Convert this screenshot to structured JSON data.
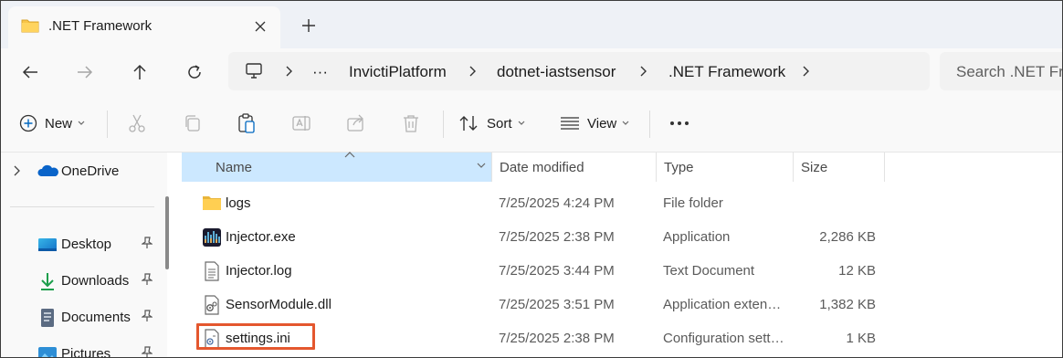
{
  "window": {
    "tab_title": ".NET Framework"
  },
  "address_bar": {
    "more_label": "···",
    "breadcrumbs": [
      "InvictiPlatform",
      "dotnet-iastsensor",
      ".NET Framework"
    ],
    "search_placeholder": "Search .NET Framework"
  },
  "toolbar": {
    "new_label": "New",
    "sort_label": "Sort",
    "view_label": "View",
    "more_label": "···"
  },
  "sidebar": {
    "items": [
      {
        "label": "OneDrive",
        "icon": "onedrive-icon",
        "pinned": false
      },
      {
        "label": "Desktop",
        "icon": "desktop-icon",
        "pinned": true
      },
      {
        "label": "Downloads",
        "icon": "downloads-icon",
        "pinned": true
      },
      {
        "label": "Documents",
        "icon": "documents-icon",
        "pinned": true
      },
      {
        "label": "Pictures",
        "icon": "pictures-icon",
        "pinned": true
      }
    ]
  },
  "file_list": {
    "columns": {
      "name": "Name",
      "date": "Date modified",
      "type": "Type",
      "size": "Size"
    },
    "rows": [
      {
        "name": "logs",
        "date": "7/25/2025 4:24 PM",
        "type": "File folder",
        "size": "",
        "icon": "folder-icon"
      },
      {
        "name": "Injector.exe",
        "date": "7/25/2025 2:38 PM",
        "type": "Application",
        "size": "2,286 KB",
        "icon": "exe-icon"
      },
      {
        "name": "Injector.log",
        "date": "7/25/2025 3:44 PM",
        "type": "Text Document",
        "size": "12 KB",
        "icon": "text-file-icon"
      },
      {
        "name": "SensorModule.dll",
        "date": "7/25/2025 3:51 PM",
        "type": "Application extens…",
        "size": "1,382 KB",
        "icon": "dll-icon"
      },
      {
        "name": "settings.ini",
        "date": "7/25/2025 2:38 PM",
        "type": "Configuration setti…",
        "size": "1 KB",
        "icon": "ini-file-icon"
      }
    ]
  },
  "colors": {
    "accent": "#0067c0",
    "folder": "#f8c548",
    "selection_header": "#cce8ff",
    "highlight_box": "#e4572e"
  }
}
